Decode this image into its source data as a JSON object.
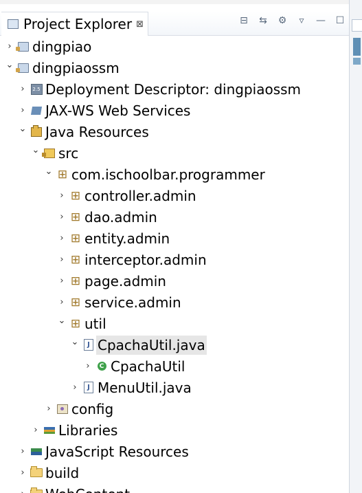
{
  "view": {
    "title": "Project Explorer",
    "close_glyph": "⊠",
    "toolbar": [
      {
        "name": "collapse-all-icon",
        "glyph": "⊟"
      },
      {
        "name": "link-with-editor-icon",
        "glyph": "⇆"
      },
      {
        "name": "filter-icon",
        "glyph": "⚙"
      },
      {
        "name": "view-menu-icon",
        "glyph": "▿"
      },
      {
        "name": "minimize-icon",
        "glyph": "—"
      },
      {
        "name": "maximize-icon",
        "glyph": "☐"
      }
    ]
  },
  "tree": [
    {
      "label": "dingpiao",
      "icon": "project-icon",
      "depth": 0,
      "twisty": "collapsed"
    },
    {
      "label": "dingpiaossm",
      "icon": "project-icon",
      "depth": 0,
      "twisty": "expanded"
    },
    {
      "label": "Deployment Descriptor: dingpiaossm",
      "icon": "deployment-descriptor-icon",
      "depth": 1,
      "twisty": "collapsed"
    },
    {
      "label": "JAX-WS Web Services",
      "icon": "web-services-icon",
      "depth": 1,
      "twisty": "collapsed"
    },
    {
      "label": "Java Resources",
      "icon": "java-resources-icon",
      "depth": 1,
      "twisty": "expanded"
    },
    {
      "label": "src",
      "icon": "source-folder-icon",
      "depth": 2,
      "twisty": "expanded"
    },
    {
      "label": "com.ischoolbar.programmer",
      "icon": "package-icon",
      "depth": 3,
      "twisty": "expanded"
    },
    {
      "label": "controller.admin",
      "icon": "package-icon",
      "depth": 4,
      "twisty": "collapsed"
    },
    {
      "label": "dao.admin",
      "icon": "package-icon",
      "depth": 4,
      "twisty": "collapsed"
    },
    {
      "label": "entity.admin",
      "icon": "package-icon",
      "depth": 4,
      "twisty": "collapsed"
    },
    {
      "label": "interceptor.admin",
      "icon": "package-icon",
      "depth": 4,
      "twisty": "collapsed"
    },
    {
      "label": "page.admin",
      "icon": "package-icon",
      "depth": 4,
      "twisty": "collapsed"
    },
    {
      "label": "service.admin",
      "icon": "package-icon",
      "depth": 4,
      "twisty": "collapsed"
    },
    {
      "label": "util",
      "icon": "package-icon",
      "depth": 4,
      "twisty": "expanded"
    },
    {
      "label": "CpachaUtil.java",
      "icon": "java-file-icon",
      "depth": 5,
      "twisty": "expanded",
      "selected": true
    },
    {
      "label": "CpachaUtil",
      "icon": "class-icon",
      "depth": 6,
      "twisty": "collapsed"
    },
    {
      "label": "MenuUtil.java",
      "icon": "java-file-icon",
      "depth": 5,
      "twisty": "collapsed"
    },
    {
      "label": "config",
      "icon": "config-folder-icon",
      "depth": 3,
      "twisty": "collapsed"
    },
    {
      "label": "Libraries",
      "icon": "libraries-icon",
      "depth": 2,
      "twisty": "collapsed"
    },
    {
      "label": "JavaScript Resources",
      "icon": "javascript-resources-icon",
      "depth": 1,
      "twisty": "collapsed"
    },
    {
      "label": "build",
      "icon": "folder-icon",
      "depth": 1,
      "twisty": "collapsed"
    },
    {
      "label": "WebContent",
      "icon": "folder-icon",
      "depth": 1,
      "twisty": "collapsed"
    }
  ],
  "colors": {
    "selection": "#e6e6e6",
    "accent": "#5f8fb5"
  }
}
